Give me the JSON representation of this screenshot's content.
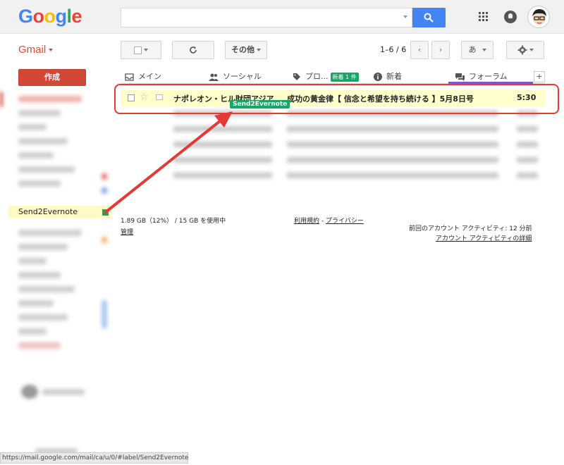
{
  "header": {
    "logo_letters": [
      {
        "ch": "G",
        "color": "#4285f4"
      },
      {
        "ch": "o",
        "color": "#ea4335"
      },
      {
        "ch": "o",
        "color": "#fbbc05"
      },
      {
        "ch": "g",
        "color": "#4285f4"
      },
      {
        "ch": "l",
        "color": "#34a853"
      },
      {
        "ch": "e",
        "color": "#ea4335"
      }
    ],
    "search_value": ""
  },
  "toolbar": {
    "app_label": "Gmail",
    "more_label": "その他",
    "count": "1–6 / 6",
    "input_tool": "あ"
  },
  "sidebar": {
    "compose_label": "作成",
    "label_name": "Send2Evernote",
    "label_color": "#16a765"
  },
  "tabs": {
    "primary": "メイン",
    "social": "ソーシャル",
    "promotions": "プロ...",
    "promotions_badge": "新着 1 件",
    "updates": "新着",
    "forums": "フォーラム"
  },
  "email": {
    "sender": "ナポレオン・ヒル財団アジア",
    "subject": "成功の黄金律【 信念と希望を持ち続ける 】5月8日号",
    "time": "5:30",
    "tooltip": "Send2Evernote"
  },
  "footer": {
    "usage": "1.89 GB（12%） / 15 GB を使用中",
    "manage": "管理",
    "terms": "利用規約",
    "separator": " - ",
    "privacy": "プライバシー",
    "last_activity": "前回のアカウント アクティビティ: 12 分前",
    "activity_details": "アカウント アクティビティの詳細"
  },
  "statusbar": {
    "url": "https://mail.google.com/mail/ca/u/0/#label/Send2Evernote"
  },
  "colors": {
    "accent_red": "#dd4b39",
    "search_blue": "#4285f4",
    "label_green": "#16a765",
    "annotation_red": "#e53935",
    "highlight_yellow": "#ffffcc"
  }
}
